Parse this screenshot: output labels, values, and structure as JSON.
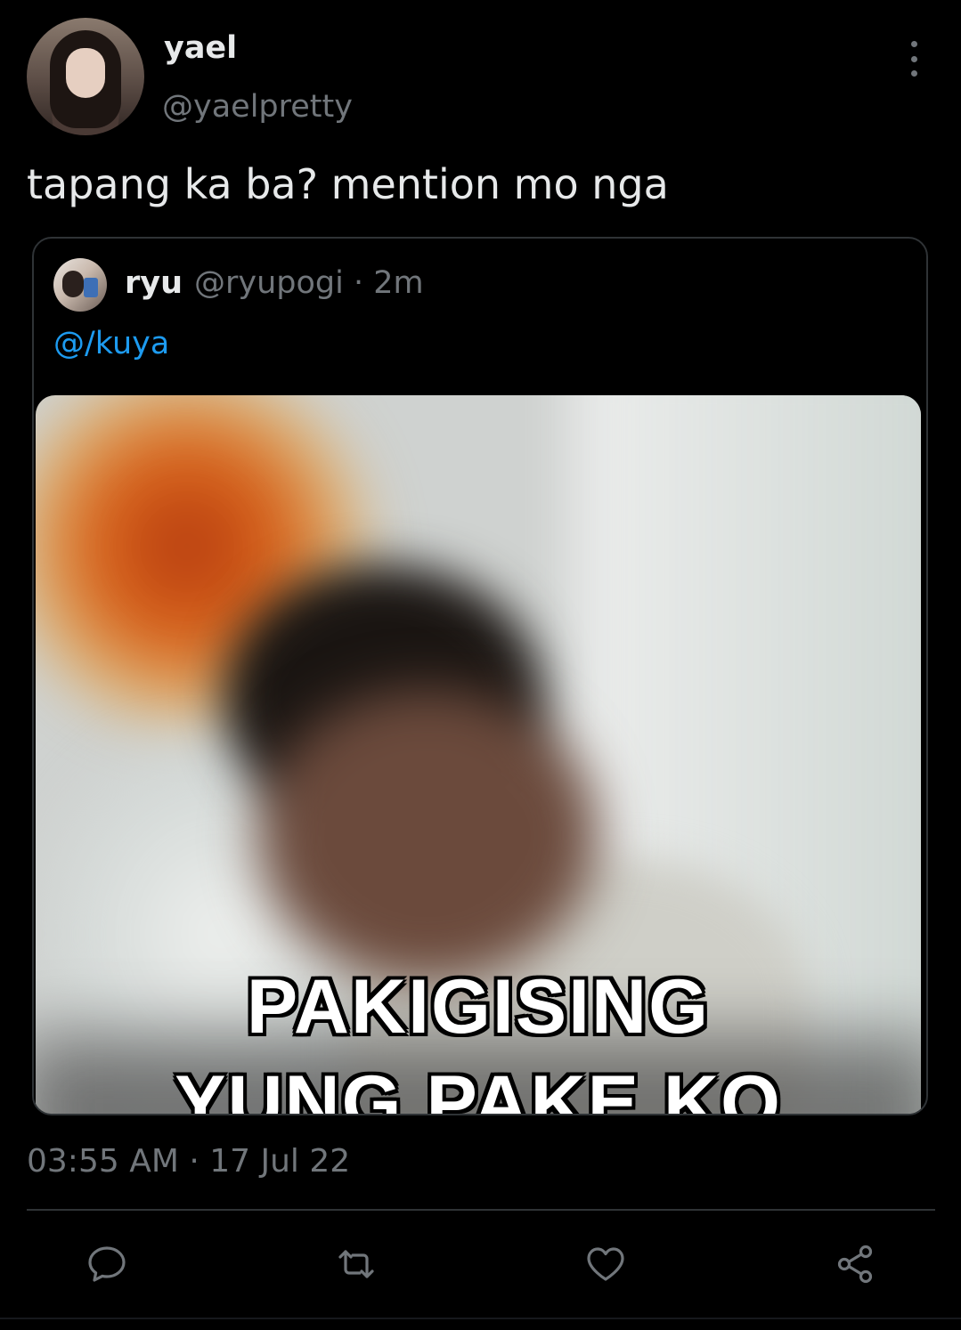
{
  "tweet": {
    "display_name": "yael",
    "handle": "@yaelpretty",
    "text": "tapang ka ba? mention mo nga",
    "timestamp": "03:55 AM · 17 Jul 22"
  },
  "quote": {
    "display_name": "ryu",
    "meta": "@ryupogi · 2m",
    "mention": "@/kuya",
    "media_text_line1": "PAKIGISING",
    "media_text_line2": "YUNG PAKE KO"
  },
  "icons": {
    "more": "more-vertical-icon",
    "reply": "reply-icon",
    "retweet": "retweet-icon",
    "like": "heart-icon",
    "share": "share-icon"
  },
  "colors": {
    "background": "#000000",
    "text": "#e7e9ea",
    "muted": "#71767b",
    "link": "#1d9bf0",
    "border": "#2f3336"
  }
}
